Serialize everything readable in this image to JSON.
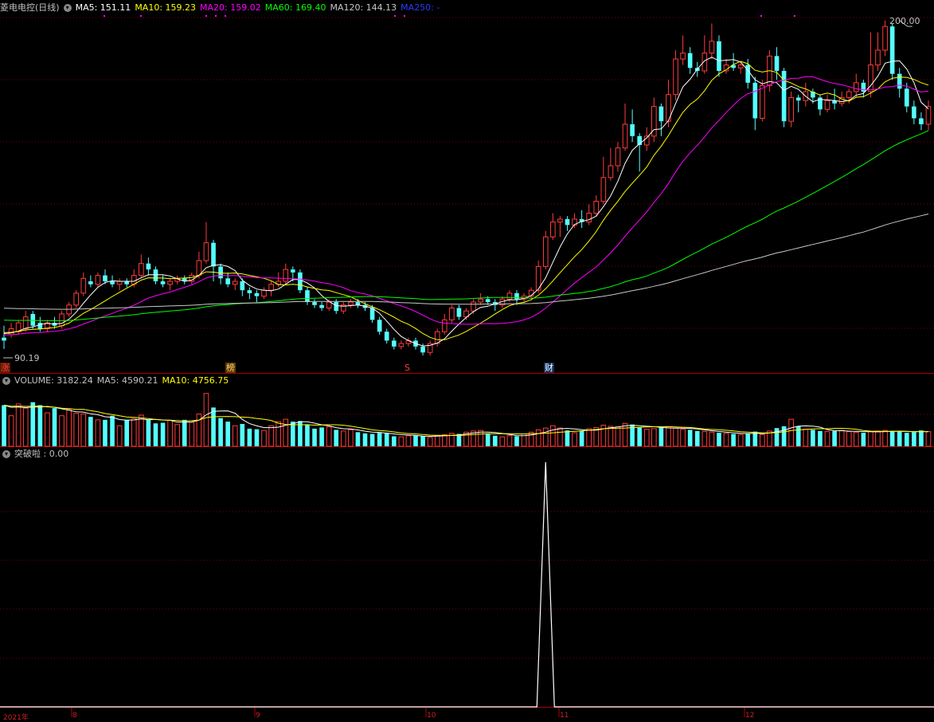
{
  "colors": {
    "up": "#ff3b3b",
    "down": "#54ffff",
    "ma5": "#ffffff",
    "ma10": "#ffff00",
    "ma20": "#ff00ff",
    "ma60": "#00ff00",
    "ma120": "#c8c8c8",
    "ma250": "#2a3bff",
    "grid": "#7a0000",
    "signal": "#ffffff"
  },
  "header": {
    "title": "菱电电控(日线)",
    "ma5": "MA5: 151.11",
    "ma10": "MA10: 159.23",
    "ma20": "MA20: 159.02",
    "ma60": "MA60: 169.40",
    "ma120": "MA120: 144.13",
    "ma250": "MA250: -"
  },
  "price_panel": {
    "high_label": "200.00",
    "low_label": "90.19",
    "tags": {
      "zhang": "涨",
      "bang": "榜",
      "s": "S",
      "cai": "财"
    }
  },
  "volume_panel": {
    "volume": "VOLUME: 3182.24",
    "ma5": "MA5: 4590.21",
    "ma10": "MA10: 4756.75"
  },
  "indicator_panel": {
    "label": "突破啦 : 0.00"
  },
  "x_axis": {
    "year": "2021年",
    "months": [
      "8",
      "9",
      "10",
      "11",
      "12"
    ]
  },
  "chart_data": [
    {
      "type": "candlestick",
      "title": "菱电电控(日线)",
      "ylim": [
        88,
        202
      ],
      "candles": [
        [
          94,
          93,
          98,
          90.19
        ],
        [
          95,
          97,
          99,
          94
        ],
        [
          96,
          99,
          100,
          95
        ],
        [
          97,
          101,
          103,
          96
        ],
        [
          102,
          98,
          103,
          97
        ],
        [
          99,
          97,
          101,
          96
        ],
        [
          97,
          99,
          100,
          96
        ],
        [
          99,
          98,
          101,
          97
        ],
        [
          98,
          102,
          103,
          97
        ],
        [
          102,
          105,
          106,
          101
        ],
        [
          105,
          109,
          110,
          104
        ],
        [
          109,
          114,
          116,
          108
        ],
        [
          113,
          112,
          115,
          111
        ],
        [
          112,
          115,
          116,
          111
        ],
        [
          115,
          113,
          117,
          112
        ],
        [
          113,
          112,
          115,
          111
        ],
        [
          112,
          113,
          114,
          110
        ],
        [
          113,
          112,
          114,
          111
        ],
        [
          112,
          115,
          117,
          111
        ],
        [
          115,
          119,
          122,
          114
        ],
        [
          119,
          117,
          121,
          115
        ],
        [
          117,
          113,
          118,
          112
        ],
        [
          113,
          112,
          115,
          111
        ],
        [
          112,
          113,
          114,
          110
        ],
        [
          113,
          114,
          115,
          112
        ],
        [
          114,
          113,
          115,
          112
        ],
        [
          113,
          115,
          116,
          112
        ],
        [
          115,
          120,
          123,
          114
        ],
        [
          120,
          126,
          133,
          119
        ],
        [
          126,
          118,
          127,
          113
        ],
        [
          118,
          114,
          119,
          112
        ],
        [
          114,
          112,
          116,
          111
        ],
        [
          112,
          113,
          114,
          110
        ],
        [
          113,
          110,
          114,
          108
        ],
        [
          110,
          109,
          111,
          107
        ],
        [
          109,
          108,
          110,
          106
        ],
        [
          108,
          110,
          111,
          107
        ],
        [
          110,
          112,
          113,
          108
        ],
        [
          112,
          113,
          116,
          111
        ],
        [
          113,
          117,
          119,
          112
        ],
        [
          117,
          116,
          118,
          113
        ],
        [
          116,
          110,
          117,
          109
        ],
        [
          110,
          106,
          111,
          105
        ],
        [
          106,
          105,
          107,
          104
        ],
        [
          105,
          104,
          106,
          103
        ],
        [
          104,
          106,
          107,
          103
        ],
        [
          106,
          103,
          107,
          102
        ],
        [
          103,
          105,
          106,
          102
        ],
        [
          105,
          106,
          107,
          104
        ],
        [
          106,
          105,
          107,
          104
        ],
        [
          105,
          104,
          106,
          103
        ],
        [
          104,
          100,
          105,
          99
        ],
        [
          100,
          96,
          101,
          95
        ],
        [
          96,
          93,
          97,
          92
        ],
        [
          93,
          91,
          94,
          90
        ],
        [
          91,
          92,
          93,
          90
        ],
        [
          92,
          93,
          94,
          91
        ],
        [
          93,
          91,
          94,
          90
        ],
        [
          91,
          89,
          92,
          88
        ],
        [
          89,
          92,
          93,
          88
        ],
        [
          92,
          96,
          97,
          91
        ],
        [
          96,
          100,
          102,
          95
        ],
        [
          100,
          104,
          105,
          99
        ],
        [
          104,
          101,
          105,
          100
        ],
        [
          101,
          103,
          104,
          100
        ],
        [
          103,
          106,
          107,
          102
        ],
        [
          106,
          107,
          109,
          105
        ],
        [
          107,
          106,
          108,
          105
        ],
        [
          106,
          105,
          107,
          103
        ],
        [
          105,
          107,
          108,
          104
        ],
        [
          107,
          109,
          110,
          106
        ],
        [
          109,
          107,
          110,
          105
        ],
        [
          107,
          108,
          109,
          106
        ],
        [
          108,
          110,
          111,
          107
        ],
        [
          110,
          118,
          120,
          109
        ],
        [
          118,
          128,
          130,
          117
        ],
        [
          128,
          133,
          136,
          127
        ],
        [
          133,
          134,
          135,
          128
        ],
        [
          134,
          132,
          135,
          130
        ],
        [
          132,
          134,
          136,
          131
        ],
        [
          134,
          133,
          137,
          131
        ],
        [
          133,
          136,
          139,
          132
        ],
        [
          136,
          140,
          142,
          135
        ],
        [
          140,
          148,
          155,
          139
        ],
        [
          148,
          152,
          158,
          147
        ],
        [
          152,
          158,
          160,
          150
        ],
        [
          158,
          166,
          173,
          157
        ],
        [
          166,
          162,
          171,
          160
        ],
        [
          162,
          159,
          163,
          150
        ],
        [
          159,
          162,
          165,
          157
        ],
        [
          162,
          172,
          175,
          160
        ],
        [
          172,
          167,
          173,
          162
        ],
        [
          167,
          176,
          181,
          165
        ],
        [
          176,
          188,
          191,
          174
        ],
        [
          188,
          190,
          196,
          186
        ],
        [
          190,
          185,
          192,
          183
        ],
        [
          185,
          184,
          187,
          182
        ],
        [
          184,
          190,
          196,
          183
        ],
        [
          190,
          194,
          200,
          188
        ],
        [
          194,
          184,
          196,
          182
        ],
        [
          184,
          186,
          188,
          183
        ],
        [
          186,
          185,
          190,
          184
        ],
        [
          185,
          186,
          187,
          183
        ],
        [
          186,
          180,
          188,
          178
        ],
        [
          180,
          168,
          182,
          164
        ],
        [
          168,
          179,
          181,
          167
        ],
        [
          179,
          189,
          191,
          177
        ],
        [
          189,
          184,
          192,
          181
        ],
        [
          184,
          167,
          185,
          165
        ],
        [
          167,
          175,
          177,
          165
        ],
        [
          175,
          174,
          176,
          170
        ],
        [
          174,
          177,
          180,
          172
        ],
        [
          177,
          175,
          178,
          173
        ],
        [
          175,
          171,
          176,
          169
        ],
        [
          171,
          174,
          176,
          170
        ],
        [
          174,
          173,
          178,
          171
        ],
        [
          173,
          175,
          177,
          172
        ],
        [
          175,
          177,
          178,
          173
        ],
        [
          177,
          180,
          183,
          175
        ],
        [
          180,
          177,
          181,
          175
        ],
        [
          177,
          186,
          197,
          175
        ],
        [
          186,
          191,
          197,
          184
        ],
        [
          191,
          199,
          201,
          189
        ],
        [
          199,
          183,
          200,
          181
        ],
        [
          183,
          178,
          185,
          175
        ],
        [
          178,
          172,
          180,
          170
        ],
        [
          172,
          168,
          174,
          166
        ],
        [
          168,
          166,
          170,
          164
        ],
        [
          166,
          172,
          174,
          164
        ]
      ]
    },
    {
      "type": "bar",
      "title": "VOLUME",
      "values": [
        7000,
        5200,
        7200,
        6500,
        7500,
        7000,
        5700,
        6500,
        5200,
        6300,
        5600,
        5500,
        5000,
        4500,
        4500,
        5200,
        3500,
        4500,
        4700,
        5300,
        4500,
        3900,
        4000,
        4400,
        3700,
        4500,
        4100,
        5500,
        9000,
        6600,
        4800,
        4200,
        3500,
        3800,
        3000,
        2900,
        2700,
        3500,
        4200,
        4600,
        4200,
        4300,
        3600,
        3000,
        3200,
        3300,
        2800,
        2600,
        2800,
        2400,
        2200,
        2100,
        2300,
        2200,
        1700,
        1600,
        1800,
        1900,
        1700,
        1500,
        1800,
        2000,
        2200,
        2100,
        2400,
        2600,
        2700,
        2200,
        1800,
        1600,
        1800,
        1700,
        2100,
        2400,
        2800,
        3100,
        3500,
        3100,
        2700,
        2300,
        2600,
        3000,
        3200,
        3600,
        3400,
        3300,
        3900,
        3700,
        3200,
        2900,
        3000,
        3200,
        3300,
        3100,
        2900,
        2800,
        2600,
        2500,
        2400,
        2300,
        2200,
        2100,
        2000,
        2200,
        2500,
        2000,
        2600,
        3100,
        3400,
        4600,
        3400,
        2900,
        2800,
        2600,
        2500,
        2600,
        2700,
        2500,
        2400,
        2300,
        2500,
        2600,
        2700,
        2600,
        2500,
        2300,
        2400,
        2700,
        2500,
        2300,
        3182
      ],
      "series": [
        {
          "name": "VOLUME",
          "value": 3182.24
        },
        {
          "name": "MA5",
          "value": 4590.21
        },
        {
          "name": "MA10",
          "value": 4756.75
        }
      ]
    },
    {
      "type": "line",
      "title": "突破啦",
      "values": [
        0,
        0,
        0,
        0,
        0,
        0,
        0,
        0,
        0,
        0,
        0,
        0,
        0,
        0,
        0,
        0,
        0,
        0,
        0,
        0,
        0,
        0,
        0,
        0,
        0,
        0,
        0,
        0,
        0,
        0,
        0,
        0,
        0,
        0,
        0,
        0,
        0,
        0,
        0,
        0,
        0,
        0,
        0,
        0,
        0,
        0,
        0,
        0,
        0,
        0,
        0,
        0,
        0,
        0,
        0,
        0,
        0,
        0,
        0,
        0,
        0,
        0,
        0,
        0,
        0,
        0,
        0,
        0,
        0,
        0,
        0,
        0,
        0,
        0,
        0,
        0,
        0,
        0,
        0,
        0,
        0,
        0,
        0,
        0,
        0,
        0,
        0,
        0,
        0,
        0,
        0,
        0,
        0,
        0,
        0,
        0,
        0,
        0,
        0,
        0,
        0,
        0,
        0,
        0,
        0,
        0,
        0,
        0,
        0,
        0,
        0,
        0,
        0,
        0,
        0,
        0,
        0,
        0,
        0,
        0,
        0,
        0,
        0,
        0,
        0,
        0,
        0,
        0,
        0,
        0,
        0,
        0,
        0,
        0,
        0,
        0,
        0,
        0,
        0,
        0,
        0,
        0,
        0,
        0,
        0,
        0,
        0,
        0,
        0,
        0
      ],
      "spike": {
        "index": 75,
        "value": 1
      }
    }
  ]
}
